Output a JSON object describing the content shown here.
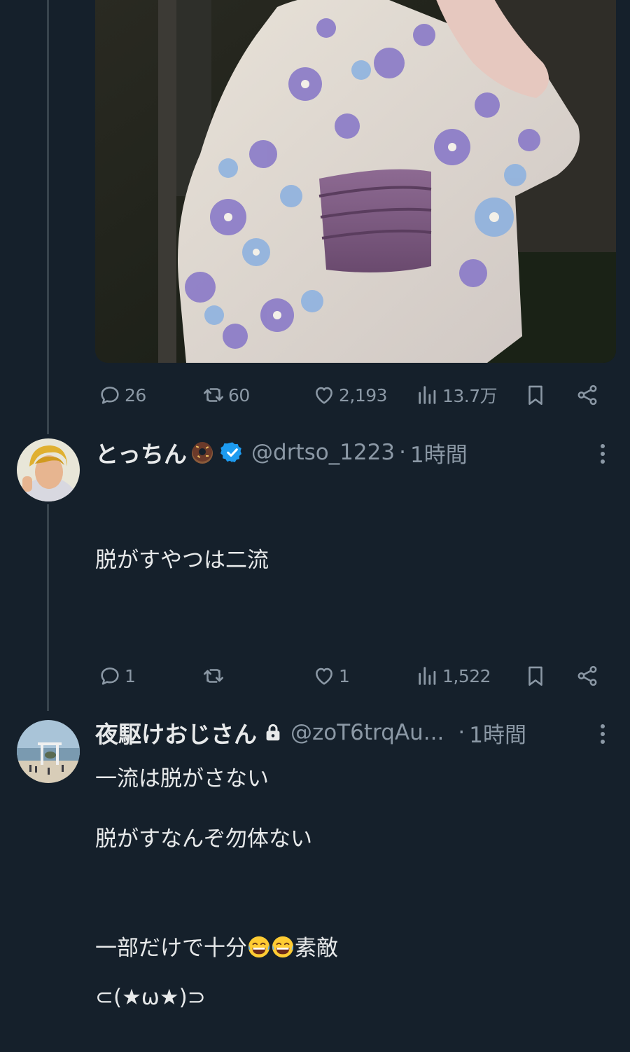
{
  "post_stats": {
    "replies": "26",
    "retweets": "60",
    "likes": "2,193",
    "views": "13.7万"
  },
  "replies": [
    {
      "name": "とっちん",
      "handle": "@drtso_1223",
      "separator": "·",
      "time": "1時間",
      "lines": [
        "脱がすやつは二流",
        "",
        "一流は脱がさない",
        "",
        "⊂(★ω★)⊃"
      ],
      "replies": "1",
      "likes": "1",
      "views": "1,522"
    },
    {
      "name": "夜駆けおじさん",
      "handle": "@zoT6trqAu...",
      "separator": "·",
      "time": "1時間",
      "line1": "脱がすなんぞ勿体ない",
      "line2_a": "一部だけで十分",
      "line2_b": "素敵"
    }
  ],
  "colors": {
    "background": "#15202b",
    "text": "#e7e9ea",
    "muted": "#8b98a5",
    "verified": "#1d9bf0",
    "thread_line": "#38444d"
  },
  "icons": [
    "reply-icon",
    "retweet-icon",
    "like-icon",
    "views-icon",
    "bookmark-icon",
    "share-icon",
    "more-icon",
    "verified-icon",
    "lock-icon",
    "donut-emoji",
    "laughing-emoji"
  ]
}
